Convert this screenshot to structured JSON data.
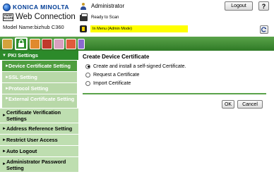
{
  "brand": {
    "company": "KONICA MINOLTA",
    "pswc_badge": "PAGE SCOPE",
    "product": "Web Connection",
    "model": "Model Name:bizhub C360"
  },
  "user": {
    "name": "Administrator"
  },
  "status": {
    "scanner": "Ready to Scan",
    "mode": "In Menu (Admin Mode)"
  },
  "header_buttons": {
    "logout": "Logout",
    "help": "?"
  },
  "toolbar": {
    "icons": [
      "maintenance-icon",
      "security-icon",
      "user-auth-icon",
      "network-icon",
      "box-icon",
      "print-setting-icon",
      "store-address-icon"
    ]
  },
  "sidebar": {
    "pki": "PKI Settings",
    "pki_sub": [
      "Device Certificate Setting",
      "SSL Setting",
      "Protocol Setting",
      "External Certificate Setting"
    ],
    "items": [
      "Certificate Verification Settings",
      "Address Reference Setting",
      "Restrict User Access",
      "Auto Logout",
      "Administrator Password Setting"
    ]
  },
  "content": {
    "title": "Create Device Certificate",
    "options": [
      "Create and install a self-signed Certificate.",
      "Request a Certificate",
      "Import Certificate"
    ],
    "selected_option": "Create and install a self-signed Certificate.",
    "ok": "OK",
    "cancel": "Cancel"
  },
  "colors": {
    "accent_green": "#2f7a26",
    "highlight_yellow": "#ffff00"
  }
}
